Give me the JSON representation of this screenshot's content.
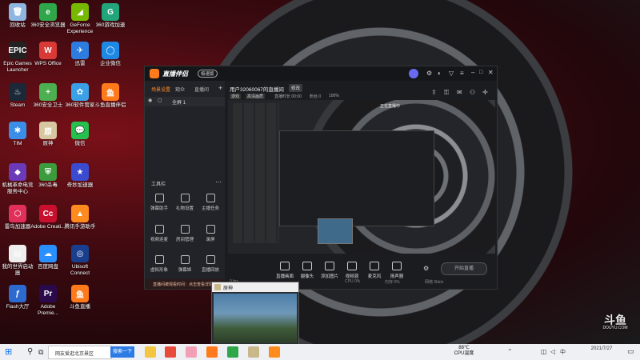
{
  "desktop": {
    "icons": [
      {
        "label": "回收站",
        "color": "#8fb6e0",
        "glyph": "🗑"
      },
      {
        "label": "360安全浏览器",
        "color": "#2fa64a",
        "glyph": "e"
      },
      {
        "label": "GeForce Experience",
        "color": "#76b900",
        "glyph": "◢"
      },
      {
        "label": "360游戏加速",
        "color": "#22a57a",
        "glyph": "G"
      },
      {
        "label": "Epic Games Launcher",
        "color": "#222",
        "glyph": "EPIC"
      },
      {
        "label": "WPS Office",
        "color": "#d93a35",
        "glyph": "W"
      },
      {
        "label": "迅雷",
        "color": "#2d7de0",
        "glyph": "✈"
      },
      {
        "label": "企业微信",
        "color": "#1e88e5",
        "glyph": "◯"
      },
      {
        "label": "Steam",
        "color": "#1b2838",
        "glyph": "♨"
      },
      {
        "label": "360安全卫士",
        "color": "#4caf50",
        "glyph": "+"
      },
      {
        "label": "360软件管家",
        "color": "#3aa1e8",
        "glyph": "✿"
      },
      {
        "label": "斗鱼直播伴侣",
        "color": "#ff7a1a",
        "glyph": "鱼"
      },
      {
        "label": "TIM",
        "color": "#3b8ee8",
        "glyph": "✱"
      },
      {
        "label": "原神",
        "color": "#d7c7a0",
        "glyph": "原"
      },
      {
        "label": "微信",
        "color": "#25c04e",
        "glyph": "💬"
      },
      {
        "label": "机械革命电竞服务中心",
        "color": "#6a3ab8",
        "glyph": "◆"
      },
      {
        "label": "360杀毒",
        "color": "#3c9b3c",
        "glyph": "⛨"
      },
      {
        "label": "奇妙加速器",
        "color": "#3b4bd0",
        "glyph": "★"
      },
      {
        "label": "雷鸟加速器",
        "color": "#e0305a",
        "glyph": "⬡"
      },
      {
        "label": "Adobe Creati...",
        "color": "#c8102e",
        "glyph": "Cc"
      },
      {
        "label": "腾讯手游助手",
        "color": "#ff8b1f",
        "glyph": "▲"
      },
      {
        "label": "我的世界启动器",
        "color": "#eeeeee",
        "glyph": "▤"
      },
      {
        "label": "百度网盘",
        "color": "#2a8fff",
        "glyph": "☁"
      },
      {
        "label": "Ubisoft Connect",
        "color": "#1a3e8e",
        "glyph": "◎"
      },
      {
        "label": "Flash大厅",
        "color": "#2d6ad0",
        "glyph": "ƒ"
      },
      {
        "label": "Adobe Premie...",
        "color": "#2a0a4a",
        "glyph": "Pr"
      },
      {
        "label": "斗鱼直播",
        "color": "#ff7a1a",
        "glyph": "鱼"
      }
    ]
  },
  "app": {
    "logo": "直播伴侣",
    "badge": "极速版",
    "left_tabs": [
      "场景设置",
      "观众",
      "直播间"
    ],
    "scene_name": "全屏 1",
    "tools_title": "工具栏",
    "tools": [
      {
        "label": "弹幕助手"
      },
      {
        "label": "礼物设置"
      },
      {
        "label": "主播任务"
      },
      {
        "label": "视频连麦"
      },
      {
        "label": "房间管理"
      },
      {
        "label": "录屏"
      },
      {
        "label": "虚拟形象"
      },
      {
        "label": "弹幕姬"
      },
      {
        "label": "直播回放"
      }
    ],
    "notice": "直播间被观看时间：点击查看详情",
    "room_title": "用户32060067的直播间",
    "room_edit": "修改",
    "room_tags": [
      "游戏",
      "高清画质"
    ],
    "room_meta": [
      "直播时长 00:00",
      "粉丝 0",
      "100%"
    ],
    "preview_caption": "正在直播中",
    "controls": [
      {
        "label": "直播画面"
      },
      {
        "label": "摄像头"
      },
      {
        "label": "添加图片"
      },
      {
        "label": "视频源"
      },
      {
        "label": "麦克风"
      },
      {
        "label": "扬声器"
      }
    ],
    "start_button": "开始直播",
    "status_items": [
      "0 fps",
      "CPU 0%",
      "内存 0%",
      "网络 0kb/s"
    ]
  },
  "game_window": {
    "title": "原神"
  },
  "watermark": {
    "brand": "斗鱼",
    "sub": "DOUYU.COM"
  },
  "taskbar": {
    "search_text": "网友爱逛北京景区",
    "search_button": "搜索一下",
    "weather": "88℃",
    "weather_sub": "CPU温度",
    "time": "",
    "date": "2021/7/27",
    "language": "中"
  }
}
